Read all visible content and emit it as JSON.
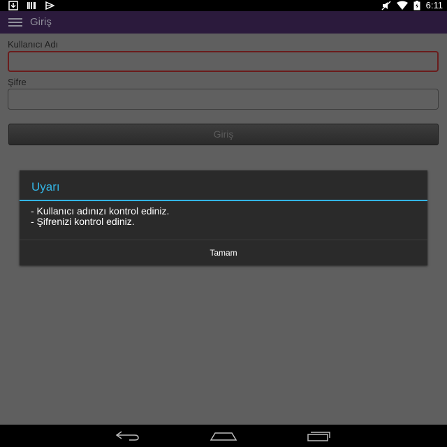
{
  "status_bar": {
    "time": "6:11",
    "left_icons": [
      "download-icon",
      "barcode-icon",
      "play-store-icon"
    ],
    "right_icons": [
      "mute-icon",
      "wifi-icon",
      "battery-icon"
    ]
  },
  "action_bar": {
    "title": "Giriş",
    "menu_icon": "menu-icon"
  },
  "form": {
    "username_label": "Kullanıcı Adı",
    "username_value": "",
    "password_label": "Şifre",
    "password_value": "",
    "login_label": "Giriş"
  },
  "dialog": {
    "title": "Uyarı",
    "messages": [
      "- Kullanıcı adınızı kontrol ediniz.",
      "- Şifrenizi kontrol ediniz."
    ],
    "ok_label": "Tamam"
  },
  "nav_bar": {
    "icons": [
      "back-icon",
      "home-icon",
      "recent-apps-icon"
    ]
  },
  "colors": {
    "accent": "#33b5e5",
    "action_bar": "#2b1a3c",
    "error_border": "#6a1c1c"
  }
}
